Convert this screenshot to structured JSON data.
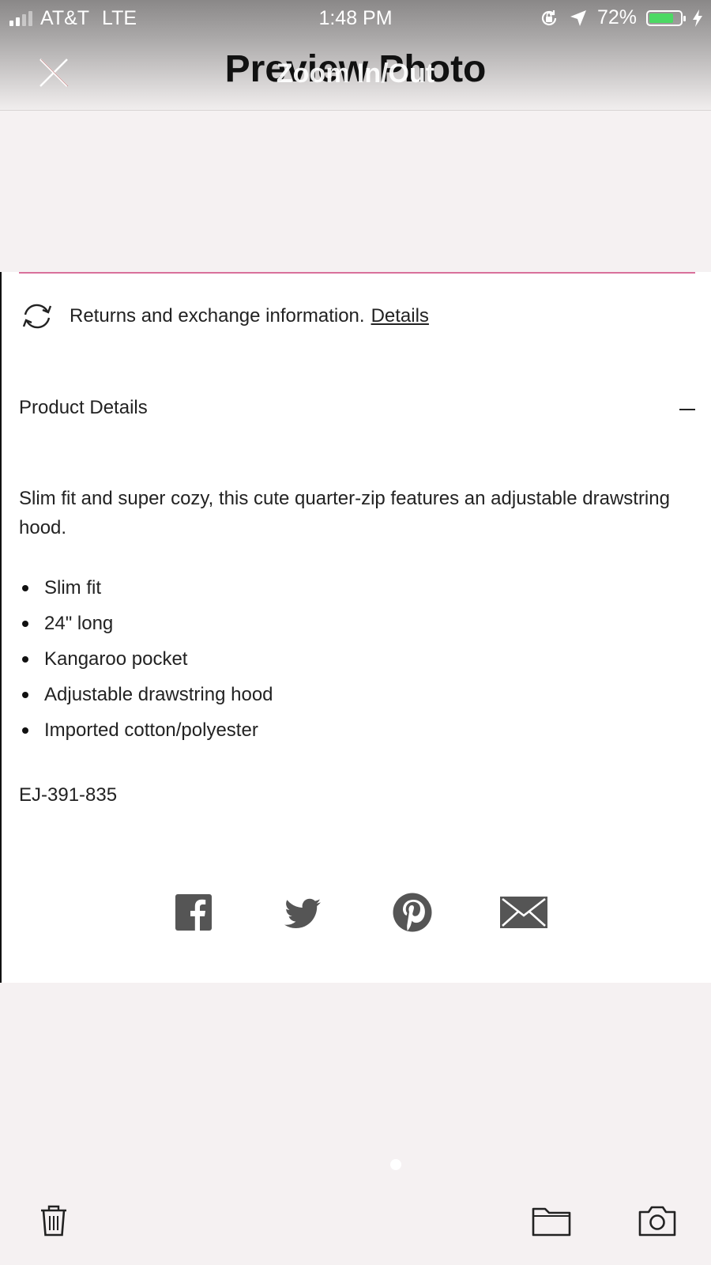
{
  "status_bar": {
    "carrier": "AT&T",
    "network": "LTE",
    "time": "1:48 PM",
    "battery": "72%"
  },
  "header": {
    "title": "Preview Photo",
    "overlay": "Zoom In/Out"
  },
  "page": {
    "returns_text": "Returns and exchange information.",
    "returns_link": "Details",
    "section_title": "Product Details",
    "description": "Slim fit and super cozy, this cute quarter-zip features an adjustable drawstring hood.",
    "bullets": [
      "Slim fit",
      "24\" long",
      "Kangaroo pocket",
      "Adjustable drawstring hood",
      "Imported cotton/polyester"
    ],
    "sku": "EJ-391-835",
    "share": [
      "facebook-icon",
      "twitter-icon",
      "pinterest-icon",
      "mail-icon"
    ]
  },
  "colors": {
    "accent_line": "#d9709b",
    "battery": "#4cd964",
    "icon_gray": "#555555"
  },
  "toolbar": [
    "trash-icon",
    "folder-icon",
    "camera-icon"
  ]
}
